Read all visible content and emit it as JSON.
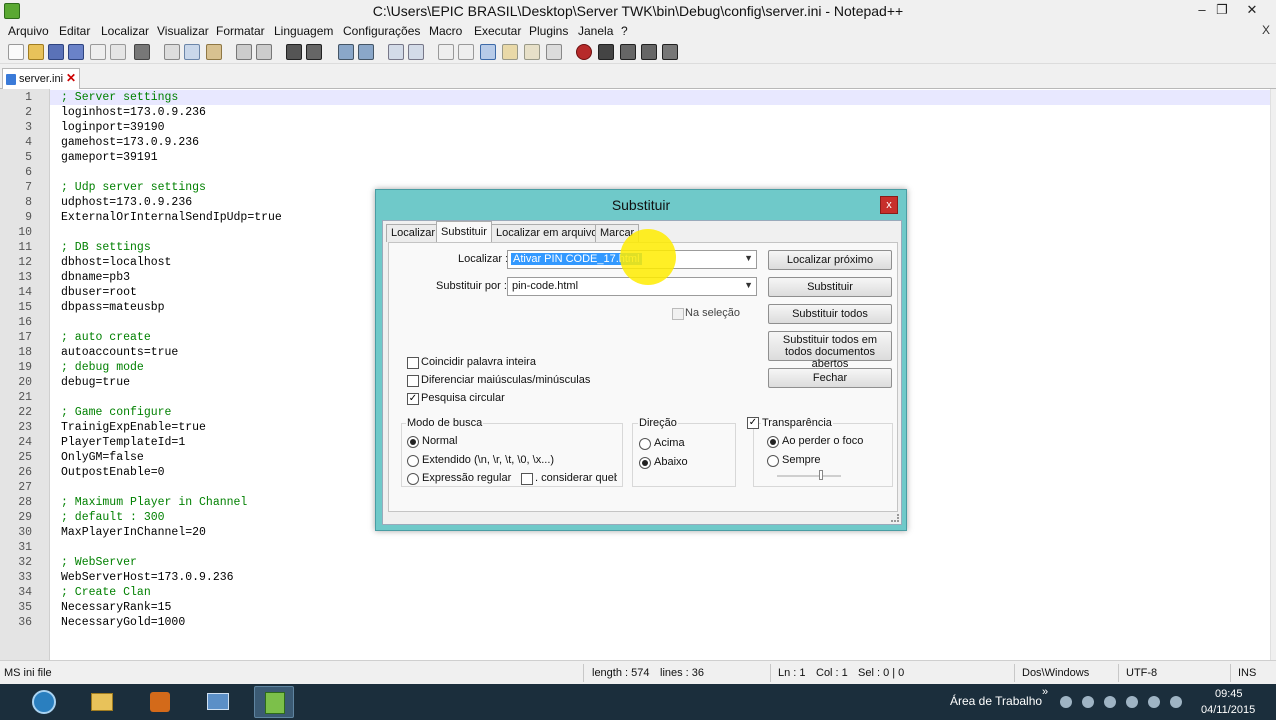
{
  "window": {
    "title": "C:\\Users\\EPIC BRASIL\\Desktop\\Server TWK\\bin\\Debug\\config\\server.ini - Notepad++",
    "minimize": "–",
    "maximize": "❐",
    "close": "✕"
  },
  "menu": [
    "Arquivo",
    "Editar",
    "Localizar",
    "Visualizar",
    "Formatar",
    "Linguagem",
    "Configurações",
    "Macro",
    "Executar",
    "Plugins",
    "Janela",
    "?"
  ],
  "menu_close": "X",
  "toolbar_icons": [
    "new-file-icon",
    "open-file-icon",
    "save-icon",
    "save-all-icon",
    "close-icon",
    "close-all-icon",
    "print-icon",
    "cut-icon",
    "copy-icon",
    "paste-icon",
    "undo-icon",
    "redo-icon",
    "find-icon",
    "replace-icon",
    "zoom-in-icon",
    "zoom-out-icon",
    "sync-vertical-icon",
    "sync-horizontal-icon",
    "word-wrap-icon",
    "show-all-chars-icon",
    "indent-guide-icon",
    "user-language-icon",
    "doc-map-icon",
    "function-list-icon",
    "record-macro-icon",
    "stop-macro-icon",
    "play-macro-icon",
    "run-macro-multiple-icon",
    "save-macro-icon"
  ],
  "tab": {
    "label": "server.ini",
    "close": "✕"
  },
  "editor": {
    "lines": [
      {
        "n": "1",
        "text": "; Server settings",
        "comment": true
      },
      {
        "n": "2",
        "text": "loginhost=173.0.9.236",
        "comment": false
      },
      {
        "n": "3",
        "text": "loginport=39190",
        "comment": false
      },
      {
        "n": "4",
        "text": "gamehost=173.0.9.236",
        "comment": false
      },
      {
        "n": "5",
        "text": "gameport=39191",
        "comment": false
      },
      {
        "n": "6",
        "text": "",
        "comment": false
      },
      {
        "n": "7",
        "text": "; Udp server settings",
        "comment": true
      },
      {
        "n": "8",
        "text": "udphost=173.0.9.236",
        "comment": false
      },
      {
        "n": "9",
        "text": "ExternalOrInternalSendIpUdp=true",
        "comment": false
      },
      {
        "n": "10",
        "text": "",
        "comment": false
      },
      {
        "n": "11",
        "text": "; DB settings",
        "comment": true
      },
      {
        "n": "12",
        "text": "dbhost=localhost",
        "comment": false
      },
      {
        "n": "13",
        "text": "dbname=pb3",
        "comment": false
      },
      {
        "n": "14",
        "text": "dbuser=root",
        "comment": false
      },
      {
        "n": "15",
        "text": "dbpass=mateusbp",
        "comment": false
      },
      {
        "n": "16",
        "text": "",
        "comment": false
      },
      {
        "n": "17",
        "text": "; auto create",
        "comment": true
      },
      {
        "n": "18",
        "text": "autoaccounts=true",
        "comment": false
      },
      {
        "n": "19",
        "text": "; debug mode",
        "comment": true
      },
      {
        "n": "20",
        "text": "debug=true",
        "comment": false
      },
      {
        "n": "21",
        "text": "",
        "comment": false
      },
      {
        "n": "22",
        "text": "; Game configure",
        "comment": true
      },
      {
        "n": "23",
        "text": "TrainigExpEnable=true",
        "comment": false
      },
      {
        "n": "24",
        "text": "PlayerTemplateId=1",
        "comment": false
      },
      {
        "n": "25",
        "text": "OnlyGM=false",
        "comment": false
      },
      {
        "n": "26",
        "text": "OutpostEnable=0",
        "comment": false
      },
      {
        "n": "27",
        "text": "",
        "comment": false
      },
      {
        "n": "28",
        "text": "; Maximum Player in Channel",
        "comment": true
      },
      {
        "n": "29",
        "text": "; default : 300",
        "comment": true
      },
      {
        "n": "30",
        "text": "MaxPlayerInChannel=20",
        "comment": false
      },
      {
        "n": "31",
        "text": "",
        "comment": false
      },
      {
        "n": "32",
        "text": "; WebServer",
        "comment": true
      },
      {
        "n": "33",
        "text": "WebServerHost=173.0.9.236",
        "comment": false
      },
      {
        "n": "34",
        "text": "; Create Clan",
        "comment": true
      },
      {
        "n": "35",
        "text": "NecessaryRank=15",
        "comment": false
      },
      {
        "n": "36",
        "text": "NecessaryGold=1000",
        "comment": false
      }
    ]
  },
  "status": {
    "file_type": "MS ini file",
    "length": "length : 574",
    "lines": "lines : 36",
    "ln": "Ln : 1",
    "col": "Col : 1",
    "sel": "Sel : 0 | 0",
    "eol": "Dos\\Windows",
    "encoding": "UTF-8",
    "mode": "INS"
  },
  "dialog": {
    "title": "Substituir",
    "close": "x",
    "tabs": [
      "Localizar",
      "Substituir",
      "Localizar em arquivos",
      "Marcar"
    ],
    "find_label": "Localizar :",
    "find_value": "Ativar PIN CODE_17.html",
    "replace_label": "Substituir por :",
    "replace_value": "pin-code.html",
    "in_selection": "Na seleção",
    "buttons": {
      "find_next": "Localizar próximo",
      "replace": "Substituir",
      "replace_all": "Substituir todos",
      "replace_all_docs": "Substituir todos em todos documentos abertos",
      "close": "Fechar"
    },
    "options": {
      "whole_word": "Coincidir palavra inteira",
      "match_case": "Diferenciar maiúsculas/minúsculas",
      "wrap": "Pesquisa circular"
    },
    "search_mode": {
      "title": "Modo de busca",
      "normal": "Normal",
      "extended": "Extendido  (\\n, \\r, \\t, \\0, \\x...)",
      "regex": "Expressão regular",
      "dot_newline": ". considerar quebr"
    },
    "direction": {
      "title": "Direção",
      "up": "Acima",
      "down": "Abaixo"
    },
    "transparency": {
      "title": "Transparência",
      "on_lose_focus": "Ao perder o foco",
      "always": "Sempre"
    }
  },
  "taskbar": {
    "desktop_label": "Área de Trabalho",
    "chevron": "»",
    "time": "09:45",
    "date": "04/11/2015"
  }
}
